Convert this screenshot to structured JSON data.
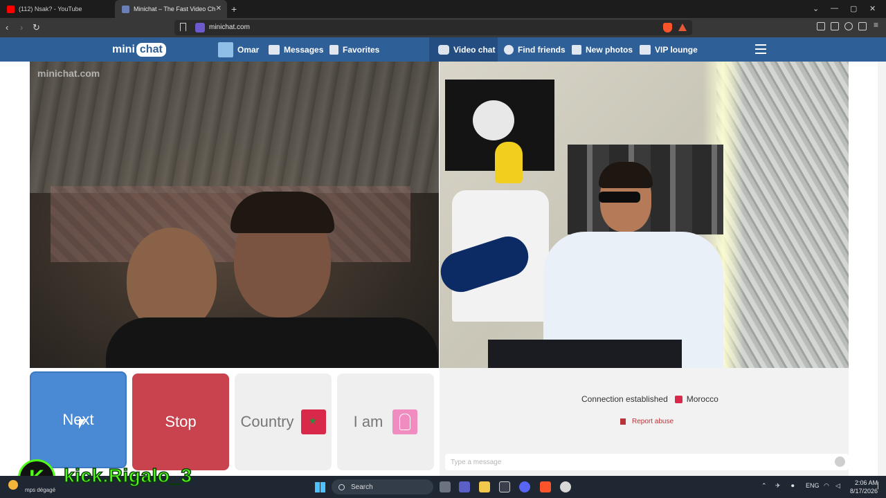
{
  "browser": {
    "tabs": [
      {
        "label": "(112) Nsak? - YouTube",
        "favicon_color": "#ff0000",
        "active": false
      },
      {
        "label": "Minichat – The Fast Video Ch",
        "favicon_color": "#6a7fb5",
        "active": true
      }
    ],
    "new_tab": "+",
    "url": "minichat.com"
  },
  "site": {
    "logo_left": "mini",
    "logo_right": "chat",
    "user": "Omar",
    "nav_left": [
      {
        "label": "Messages",
        "icon": "envelope-icon"
      },
      {
        "label": "Favorites",
        "icon": "flag-icon"
      }
    ],
    "nav_right": [
      {
        "label": "Video chat",
        "icon": "chat-bubble-icon"
      },
      {
        "label": "Find friends",
        "icon": "search-icon"
      },
      {
        "label": "New photos",
        "icon": "grid-icon"
      },
      {
        "label": "VIP lounge",
        "icon": "crown-icon"
      }
    ],
    "video_watermark": "minichat.com"
  },
  "controls": {
    "next": "Next",
    "stop": "Stop",
    "country": "Country",
    "iam": "I am"
  },
  "status": {
    "connection": "Connection established",
    "country": "Morocco",
    "report": "Report abuse",
    "message_placeholder": "Type a message"
  },
  "overlay": {
    "logo_letter": "K",
    "handle": "kick.Rigalo_3"
  },
  "taskbar": {
    "search": "Search",
    "lang": "ENG",
    "time": "2:06 AM",
    "date": "8/17/2026",
    "weather_text": "mps dégagé"
  },
  "colors": {
    "header": "#2f5f97",
    "next": "#4a8ad4",
    "stop": "#c8434d",
    "accent_green": "#53fc18"
  }
}
